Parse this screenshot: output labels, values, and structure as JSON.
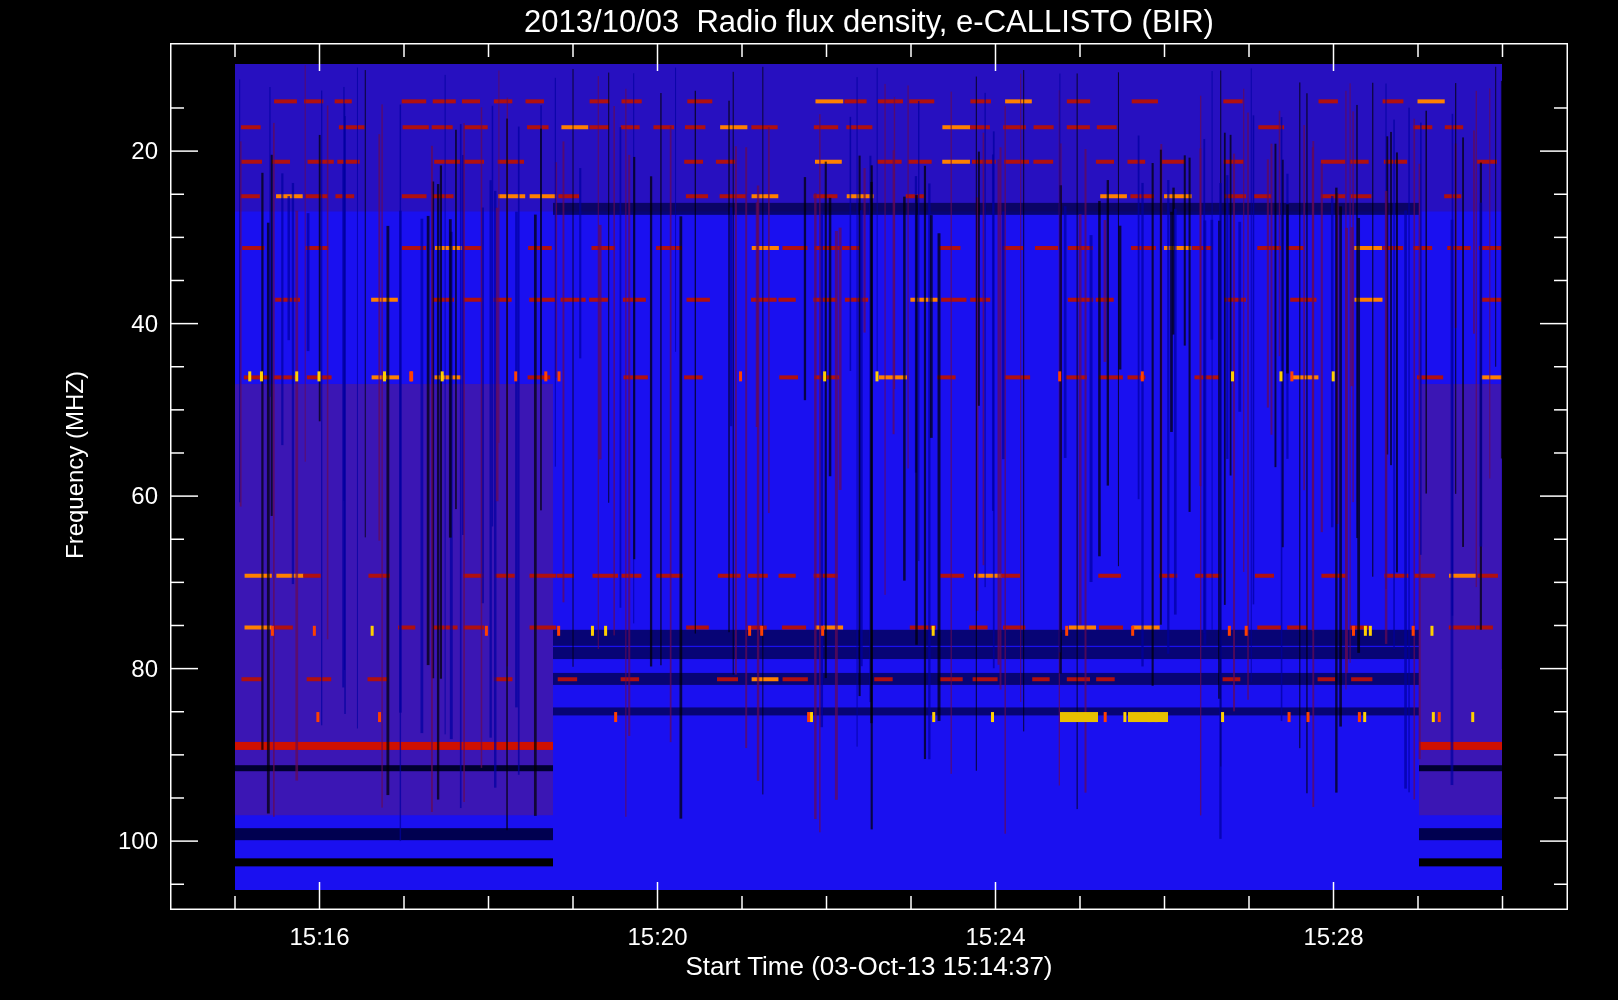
{
  "title": "2013/10/03  Radio flux density, e-CALLISTO (BIR)",
  "chart": {
    "ylabel": "Frequency (MHZ)",
    "xlabel": "Start Time (03-Oct-13 15:14:37)",
    "yticks": [
      "20",
      "40",
      "60",
      "80",
      "100"
    ],
    "xticks": [
      "15:16",
      "15:20",
      "15:24",
      "15:28"
    ]
  }
}
